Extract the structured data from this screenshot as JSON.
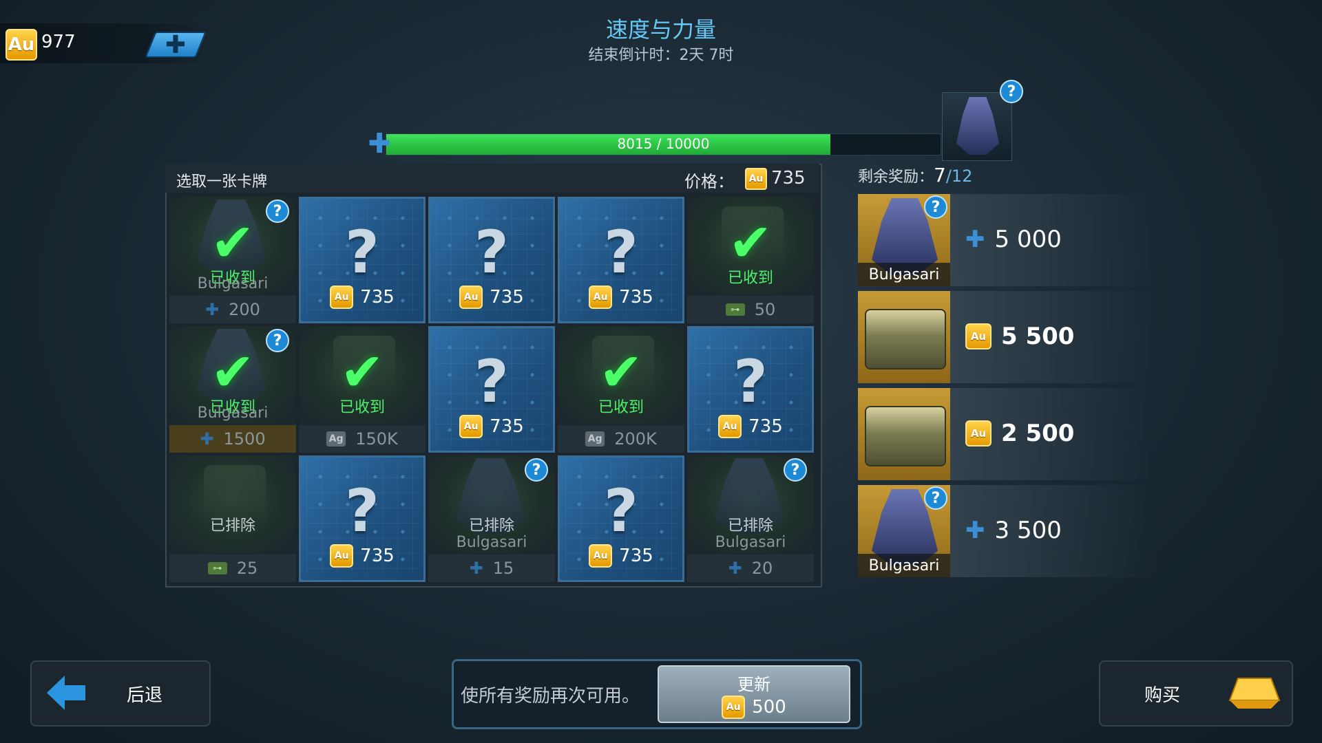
{
  "header": {
    "gold_amount": "977",
    "au_label": "Au",
    "title": "速度与力量",
    "countdown": "结束倒计时：2天 7时"
  },
  "progress": {
    "text": "8015 / 10000",
    "current": 8015,
    "max": 10000
  },
  "panel": {
    "title": "选取一张卡牌",
    "price_label": "价格：",
    "price_value": "735"
  },
  "cells": [
    {
      "state": "received",
      "name": "Bulgasari",
      "label": "已收到",
      "foot": "200",
      "foot_icon": "puzzle",
      "help": true
    },
    {
      "state": "unknown",
      "price": "735"
    },
    {
      "state": "unknown",
      "price": "735"
    },
    {
      "state": "unknown",
      "price": "735"
    },
    {
      "state": "received",
      "label": "已收到",
      "foot": "50",
      "foot_icon": "key"
    },
    {
      "state": "received",
      "name": "Bulgasari",
      "label": "已收到",
      "foot": "1500",
      "foot_icon": "puzzle",
      "help": true,
      "gold": true
    },
    {
      "state": "received",
      "label": "已收到",
      "foot": "150K",
      "foot_icon": "ag"
    },
    {
      "state": "unknown",
      "price": "735"
    },
    {
      "state": "received",
      "label": "已收到",
      "foot": "200K",
      "foot_icon": "ag"
    },
    {
      "state": "unknown",
      "price": "735"
    },
    {
      "state": "excluded",
      "label": "已排除",
      "foot": "25",
      "foot_icon": "key"
    },
    {
      "state": "unknown",
      "price": "735"
    },
    {
      "state": "excluded",
      "name": "Bulgasari",
      "label": "已排除",
      "foot": "15",
      "foot_icon": "puzzle",
      "help": true
    },
    {
      "state": "unknown",
      "price": "735"
    },
    {
      "state": "excluded",
      "name": "Bulgasari",
      "label": "已排除",
      "foot": "20",
      "foot_icon": "puzzle",
      "help": true
    }
  ],
  "rewards": {
    "label": "剩余奖励：",
    "remaining": "7",
    "total": "/12",
    "items": [
      {
        "kind": "robot",
        "name": "Bulgasari",
        "value": "5 000",
        "icon": "puzzle"
      },
      {
        "kind": "crate",
        "value": "5 500",
        "icon": "au"
      },
      {
        "kind": "crate",
        "value": "2 500",
        "icon": "au"
      },
      {
        "kind": "robot",
        "name": "Bulgasari",
        "value": "3 500",
        "icon": "puzzle"
      }
    ]
  },
  "footer": {
    "back_label": "后退",
    "refresh_text": "使所有奖励再次可用。",
    "refresh_label": "更新",
    "refresh_cost": "500",
    "buy_label": "购买"
  },
  "colors": {
    "accent_blue": "#66c8f5",
    "progress_green": "#3fe25a",
    "received_green": "#4cf26a",
    "gold": "#ffd24a"
  },
  "help_glyph": "?",
  "question_glyph": "?",
  "check_glyph": "✔",
  "plus_glyph": "✚"
}
